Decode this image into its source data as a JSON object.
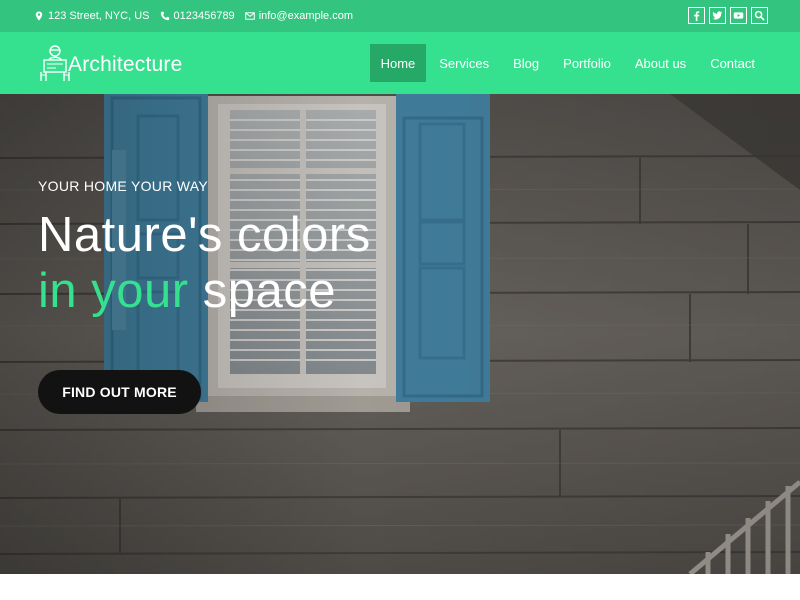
{
  "topbar": {
    "address": "123 Street, NYC, US",
    "phone": "0123456789",
    "email": "info@example.com",
    "social": [
      "facebook-icon",
      "twitter-icon",
      "youtube-icon",
      "search-icon"
    ]
  },
  "brand": {
    "name": "Architecture",
    "icon": "architect-logo-icon"
  },
  "nav": {
    "items": [
      {
        "label": "Home",
        "active": true
      },
      {
        "label": "Services",
        "active": false
      },
      {
        "label": "Blog",
        "active": false
      },
      {
        "label": "Portfolio",
        "active": false
      },
      {
        "label": "About us",
        "active": false
      },
      {
        "label": "Contact",
        "active": false
      }
    ]
  },
  "hero": {
    "kicker": "YOUR HOME YOUR WAY",
    "headline_line1": "Nature's colors",
    "headline_line2_accent": "in your",
    "headline_line2_rest": "space",
    "cta": "FIND OUT MORE"
  },
  "colors": {
    "topbar": "#33c47f",
    "navbar": "#35e08f",
    "active_nav": "#26a866",
    "accent_text": "#35e08f",
    "cta_bg": "#121212",
    "shutter_blue": "#4a93b8"
  }
}
